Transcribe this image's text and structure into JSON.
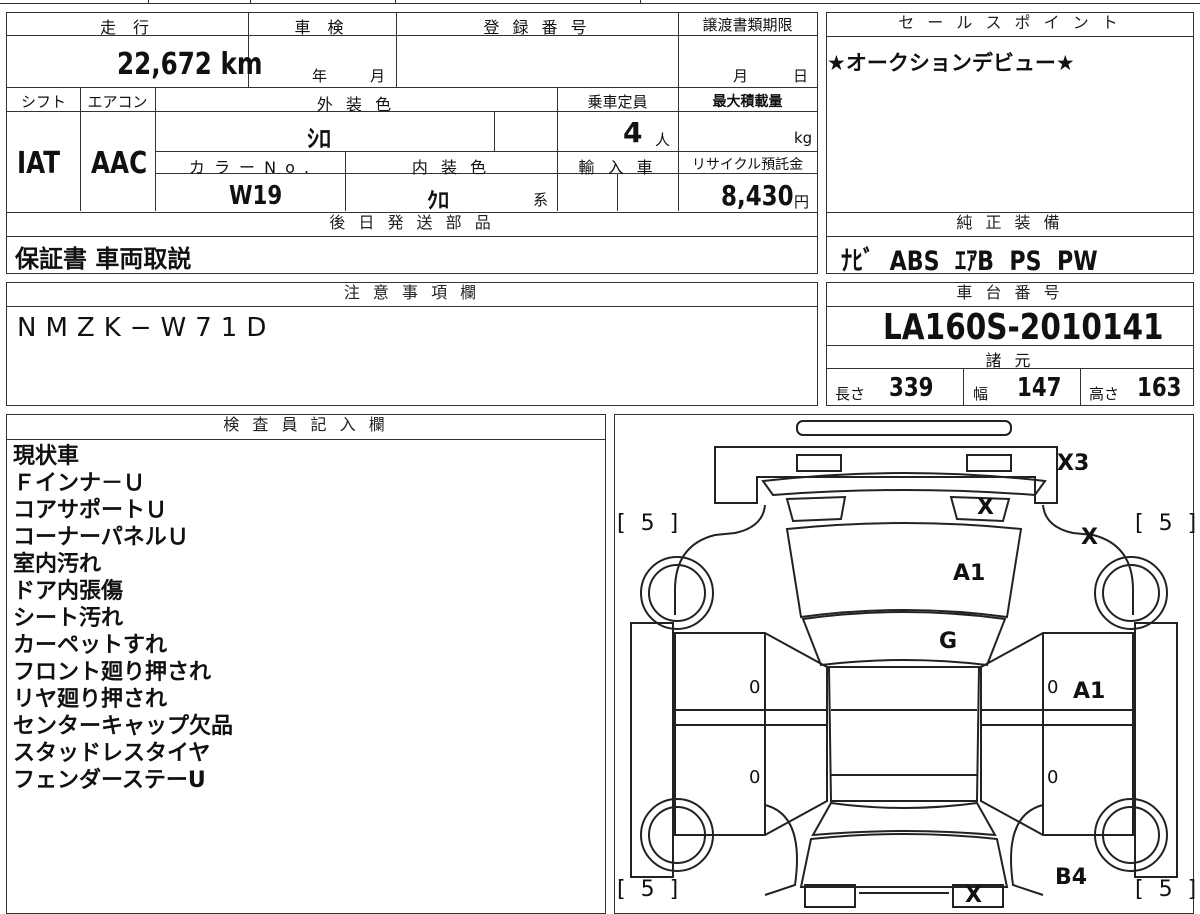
{
  "header": {
    "mileage_label": "走 行",
    "inspection_label": "車 検",
    "registration_label": "登 録 番 号",
    "transfer_deadline_label": "譲渡書類期限",
    "mileage_value": "22,672",
    "mileage_unit": "km",
    "year_label": "年",
    "month_label": "月",
    "day_label": "日"
  },
  "vehicle": {
    "shift_label": "シフト",
    "ac_label": "エアコン",
    "exterior_color_label": "外 装 色",
    "capacity_label": "乗車定員",
    "max_load_label": "最大積載量",
    "shift_value": "IAT",
    "ac_value": "AAC",
    "exterior_color_value": "ｼﾛ",
    "capacity_value": "4",
    "capacity_unit": "人",
    "load_unit": "kg",
    "color_no_label": "カ ラ ー N o .",
    "interior_color_label": "内 装 色",
    "import_label": "輸 入 車",
    "recycle_label": "リサイクル預託金",
    "color_no_value": "W19",
    "interior_color_value": "ｸﾛ",
    "interior_suffix": "系",
    "recycle_value": "8,430",
    "recycle_unit": "円"
  },
  "delivery": {
    "label": "後 日 発 送 部 品",
    "value": "保証書 車両取説"
  },
  "sales_point": {
    "label": "セ ー ル ス ポ イ ン ト",
    "value": "★オークションデビュー★"
  },
  "equipment": {
    "label": "純 正 装 備",
    "value": "ﾅﾋﾞ  ABS  ｴｱB  PS  PW"
  },
  "caution": {
    "label": "注 意 事 項 欄",
    "value": "NMZK−W71D"
  },
  "chassis": {
    "label": "車 台 番 号",
    "value": "LA160S-2010141"
  },
  "specs": {
    "label": "諸 元",
    "length_label": "長さ",
    "length_value": "339",
    "width_label": "幅",
    "width_value": "147",
    "height_label": "高さ",
    "height_value": "163"
  },
  "inspector": {
    "label": "検 査 員 記 入 欄",
    "notes": [
      "現状車",
      "Ｆインナ－Ｕ",
      "コアサポートＵ",
      "コーナーパネルＵ",
      "室内汚れ",
      "ドア内張傷",
      "シート汚れ",
      "カーペットすれ",
      "フロント廻り押され",
      "リヤ廻り押され",
      "センターキャップ欠品",
      "スタッドレスタイヤ",
      "フェンダーステーU"
    ]
  },
  "diagram": {
    "tire_fl": "[ 5 ]",
    "tire_fr": "[ 5 ]",
    "tire_rl": "[ 5 ]",
    "tire_rr": "[ 5 ]",
    "mark_front_bumper": "X3",
    "mark_headlight": "X",
    "mark_fender_right": "X",
    "mark_hood": "A1",
    "mark_windshield": "G",
    "mark_right_door": "A1",
    "mark_rear_right": "B4",
    "mark_rear_bottom": "X",
    "door_marks": [
      "0",
      "0",
      "0",
      "0"
    ]
  }
}
